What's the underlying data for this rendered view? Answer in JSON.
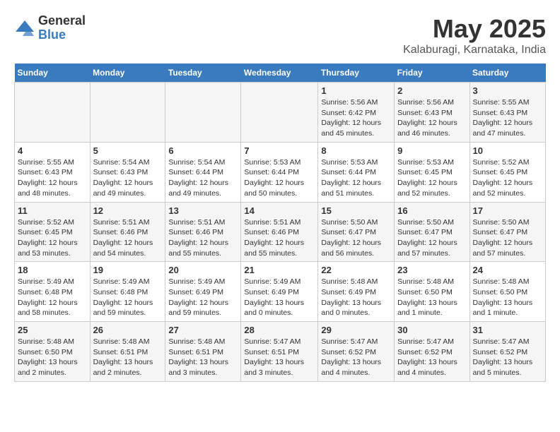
{
  "logo": {
    "general": "General",
    "blue": "Blue"
  },
  "title": "May 2025",
  "subtitle": "Kalaburagi, Karnataka, India",
  "days_of_week": [
    "Sunday",
    "Monday",
    "Tuesday",
    "Wednesday",
    "Thursday",
    "Friday",
    "Saturday"
  ],
  "weeks": [
    [
      {
        "day": "",
        "content": ""
      },
      {
        "day": "",
        "content": ""
      },
      {
        "day": "",
        "content": ""
      },
      {
        "day": "",
        "content": ""
      },
      {
        "day": "1",
        "content": "Sunrise: 5:56 AM\nSunset: 6:42 PM\nDaylight: 12 hours\nand 45 minutes."
      },
      {
        "day": "2",
        "content": "Sunrise: 5:56 AM\nSunset: 6:43 PM\nDaylight: 12 hours\nand 46 minutes."
      },
      {
        "day": "3",
        "content": "Sunrise: 5:55 AM\nSunset: 6:43 PM\nDaylight: 12 hours\nand 47 minutes."
      }
    ],
    [
      {
        "day": "4",
        "content": "Sunrise: 5:55 AM\nSunset: 6:43 PM\nDaylight: 12 hours\nand 48 minutes."
      },
      {
        "day": "5",
        "content": "Sunrise: 5:54 AM\nSunset: 6:43 PM\nDaylight: 12 hours\nand 49 minutes."
      },
      {
        "day": "6",
        "content": "Sunrise: 5:54 AM\nSunset: 6:44 PM\nDaylight: 12 hours\nand 49 minutes."
      },
      {
        "day": "7",
        "content": "Sunrise: 5:53 AM\nSunset: 6:44 PM\nDaylight: 12 hours\nand 50 minutes."
      },
      {
        "day": "8",
        "content": "Sunrise: 5:53 AM\nSunset: 6:44 PM\nDaylight: 12 hours\nand 51 minutes."
      },
      {
        "day": "9",
        "content": "Sunrise: 5:53 AM\nSunset: 6:45 PM\nDaylight: 12 hours\nand 52 minutes."
      },
      {
        "day": "10",
        "content": "Sunrise: 5:52 AM\nSunset: 6:45 PM\nDaylight: 12 hours\nand 52 minutes."
      }
    ],
    [
      {
        "day": "11",
        "content": "Sunrise: 5:52 AM\nSunset: 6:45 PM\nDaylight: 12 hours\nand 53 minutes."
      },
      {
        "day": "12",
        "content": "Sunrise: 5:51 AM\nSunset: 6:46 PM\nDaylight: 12 hours\nand 54 minutes."
      },
      {
        "day": "13",
        "content": "Sunrise: 5:51 AM\nSunset: 6:46 PM\nDaylight: 12 hours\nand 55 minutes."
      },
      {
        "day": "14",
        "content": "Sunrise: 5:51 AM\nSunset: 6:46 PM\nDaylight: 12 hours\nand 55 minutes."
      },
      {
        "day": "15",
        "content": "Sunrise: 5:50 AM\nSunset: 6:47 PM\nDaylight: 12 hours\nand 56 minutes."
      },
      {
        "day": "16",
        "content": "Sunrise: 5:50 AM\nSunset: 6:47 PM\nDaylight: 12 hours\nand 57 minutes."
      },
      {
        "day": "17",
        "content": "Sunrise: 5:50 AM\nSunset: 6:47 PM\nDaylight: 12 hours\nand 57 minutes."
      }
    ],
    [
      {
        "day": "18",
        "content": "Sunrise: 5:49 AM\nSunset: 6:48 PM\nDaylight: 12 hours\nand 58 minutes."
      },
      {
        "day": "19",
        "content": "Sunrise: 5:49 AM\nSunset: 6:48 PM\nDaylight: 12 hours\nand 59 minutes."
      },
      {
        "day": "20",
        "content": "Sunrise: 5:49 AM\nSunset: 6:49 PM\nDaylight: 12 hours\nand 59 minutes."
      },
      {
        "day": "21",
        "content": "Sunrise: 5:49 AM\nSunset: 6:49 PM\nDaylight: 13 hours\nand 0 minutes."
      },
      {
        "day": "22",
        "content": "Sunrise: 5:48 AM\nSunset: 6:49 PM\nDaylight: 13 hours\nand 0 minutes."
      },
      {
        "day": "23",
        "content": "Sunrise: 5:48 AM\nSunset: 6:50 PM\nDaylight: 13 hours\nand 1 minute."
      },
      {
        "day": "24",
        "content": "Sunrise: 5:48 AM\nSunset: 6:50 PM\nDaylight: 13 hours\nand 1 minute."
      }
    ],
    [
      {
        "day": "25",
        "content": "Sunrise: 5:48 AM\nSunset: 6:50 PM\nDaylight: 13 hours\nand 2 minutes."
      },
      {
        "day": "26",
        "content": "Sunrise: 5:48 AM\nSunset: 6:51 PM\nDaylight: 13 hours\nand 2 minutes."
      },
      {
        "day": "27",
        "content": "Sunrise: 5:48 AM\nSunset: 6:51 PM\nDaylight: 13 hours\nand 3 minutes."
      },
      {
        "day": "28",
        "content": "Sunrise: 5:47 AM\nSunset: 6:51 PM\nDaylight: 13 hours\nand 3 minutes."
      },
      {
        "day": "29",
        "content": "Sunrise: 5:47 AM\nSunset: 6:52 PM\nDaylight: 13 hours\nand 4 minutes."
      },
      {
        "day": "30",
        "content": "Sunrise: 5:47 AM\nSunset: 6:52 PM\nDaylight: 13 hours\nand 4 minutes."
      },
      {
        "day": "31",
        "content": "Sunrise: 5:47 AM\nSunset: 6:52 PM\nDaylight: 13 hours\nand 5 minutes."
      }
    ]
  ]
}
